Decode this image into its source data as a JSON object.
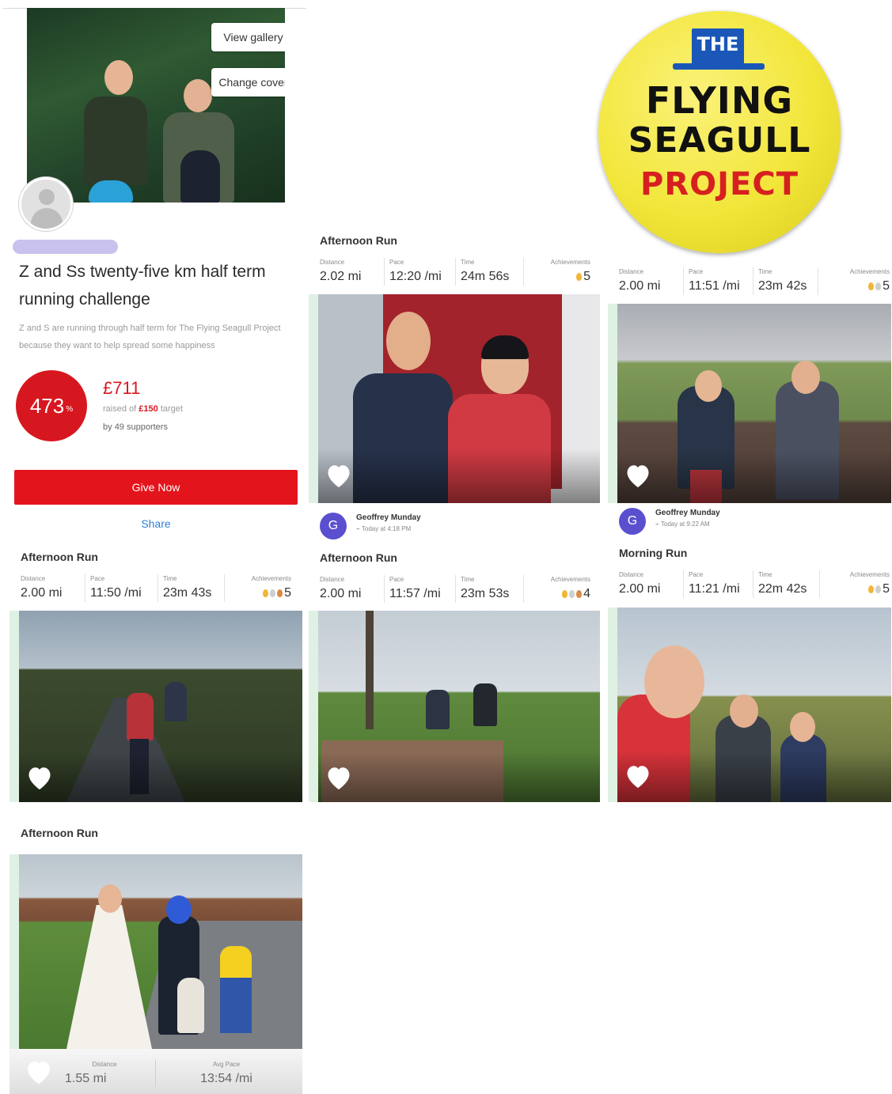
{
  "fundraiser": {
    "view_gallery": "View gallery",
    "change_cover": "Change cover",
    "title": "Z and Ss twenty-five km half term running challenge",
    "description": "Z and S are running through half term for The Flying Seagull Project because they want to help spread some happiness",
    "percent": "473",
    "percent_sign": "%",
    "raised_amount": "£711",
    "raised_prefix": "raised of",
    "target_amount": "£150",
    "target_suffix": "target",
    "supporters_prefix": "by",
    "supporters_count": "49 supporters",
    "give_now": "Give Now",
    "share": "Share"
  },
  "logo": {
    "the": "THE",
    "line1": "FLYING",
    "line2": "SEAGULL",
    "line3": "PROJECT"
  },
  "stat_labels": {
    "distance": "Distance",
    "pace": "Pace",
    "time": "Time",
    "achievements": "Achievements",
    "avg_pace": "Avg Pace"
  },
  "activities": [
    {
      "title": "Afternoon Run",
      "distance": "2.02 mi",
      "pace": "12:20 /mi",
      "time": "24m 56s",
      "achievements": "5"
    },
    {
      "title": "",
      "distance": "2.00 mi",
      "pace": "11:51 /mi",
      "time": "23m 42s",
      "achievements": "5"
    },
    {
      "title": "Afternoon Run",
      "distance": "2.00 mi",
      "pace": "11:50 /mi",
      "time": "23m 43s",
      "achievements": "5"
    },
    {
      "title": "Afternoon Run",
      "distance": "2.00 mi",
      "pace": "11:57 /mi",
      "time": "23m 53s",
      "achievements": "4"
    },
    {
      "title": "Morning Run",
      "distance": "2.00 mi",
      "pace": "11:21 /mi",
      "time": "22m 42s",
      "achievements": "5"
    },
    {
      "title": "Afternoon Run",
      "distance": "1.55 mi",
      "pace": "13:54 /mi"
    }
  ],
  "posters": [
    {
      "initial": "G",
      "name": "Geoffrey Munday",
      "time": "Today at 4:18 PM"
    },
    {
      "initial": "G",
      "name": "Geoffrey Munday",
      "time": "Today at 9:22 AM"
    }
  ],
  "colors": {
    "brand_red": "#e4141c",
    "logo_yellow": "#f2e63a",
    "logo_blue": "#1a57b8",
    "avatar_purple": "#5a4fcf"
  }
}
